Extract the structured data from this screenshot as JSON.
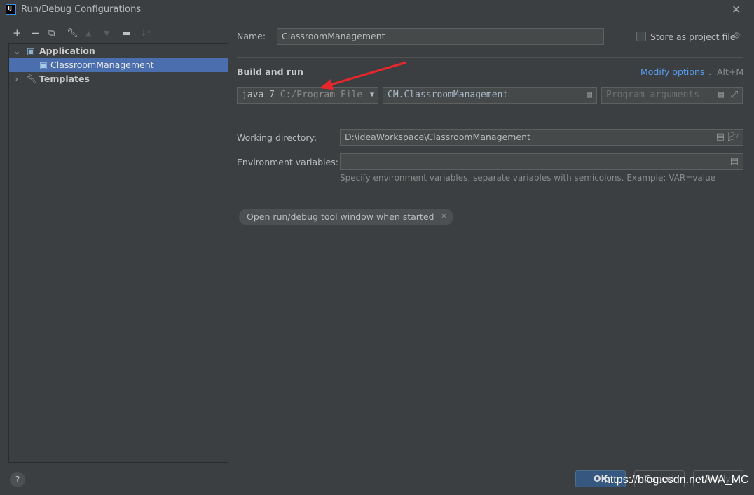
{
  "window": {
    "title": "Run/Debug Configurations",
    "logo": "IJ"
  },
  "toolbar": [
    "plus-icon",
    "minus-icon",
    "copy-icon",
    "wrench-icon",
    "arrow-up-icon",
    "arrow-down-icon",
    "new-folder-icon",
    "sort-icon"
  ],
  "tree": {
    "application": "Application",
    "config": "ClassroomManagement",
    "templates": "Templates"
  },
  "form": {
    "name_label": "Name:",
    "name_value": "ClassroomManagement",
    "store_label": "Store as project file",
    "section": "Build and run",
    "modify": "Modify options",
    "modify_shortcut": "Alt+M",
    "jre": "java 7",
    "jre_path": "C:/Program File",
    "main_class": "CM.ClassroomManagement",
    "args_placeholder": "Program arguments",
    "workdir_label": "Working directory:",
    "workdir_value": "D:\\ideaWorkspace\\ClassroomManagement",
    "env_label": "Environment variables:",
    "env_hint": "Specify environment variables, separate variables with semicolons. Example: VAR=value",
    "chip": "Open run/debug tool window when started"
  },
  "buttons": {
    "ok": "OK",
    "cancel": "Cancel",
    "apply": "Apply",
    "help": "?"
  },
  "watermark": "https://blog.csdn.net/WA_MC",
  "colors": {
    "accent": "#4b6eaf",
    "link": "#589df6",
    "arrow": "#e8262b"
  }
}
